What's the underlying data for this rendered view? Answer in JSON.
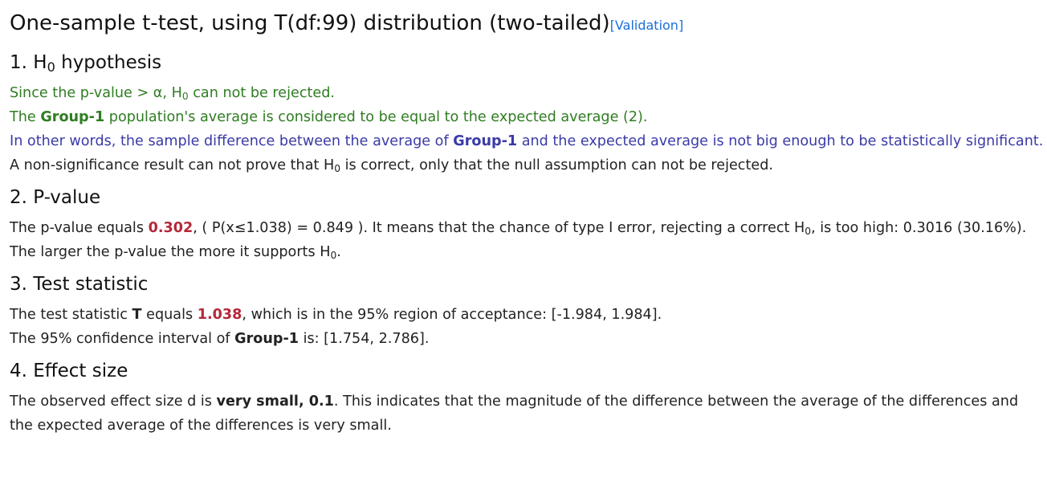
{
  "header": {
    "title": "One-sample t-test, using T(df:99) distribution (two-tailed)",
    "validation_link": "[Validation]"
  },
  "h0": {
    "heading_prefix": "1. H",
    "heading_sub": "0",
    "heading_suffix": " hypothesis",
    "line1_a": "Since the p-value > α, H",
    "line1_sub": "0",
    "line1_b": " can not be rejected.",
    "line2_a": "The ",
    "group_name": "Group-1",
    "line2_b": " population's average is considered to be equal to the expected average (2).",
    "line3_a": "In other words, the sample difference between the average of ",
    "line3_b": " and the expected average is not big enough to be statistically significant.",
    "line4_a": "A non-significance result can not prove that H",
    "line4_sub": "0",
    "line4_b": " is correct, only that the null assumption can not be rejected."
  },
  "pvalue": {
    "heading": "2. P-value",
    "text_a": "The p-value equals ",
    "value": "0.302",
    "text_b": ", ( P(x≤1.038) = 0.849 ). It means that the chance of type I error, rejecting a correct H",
    "sub1": "0",
    "text_c": ", is too high: 0.3016 (30.16%). The larger the p-value the more it supports H",
    "sub2": "0",
    "text_d": "."
  },
  "test_stat": {
    "heading": "3. Test statistic",
    "line1_a": "The test statistic ",
    "stat_symbol": "T",
    "line1_b": " equals ",
    "value": "1.038",
    "line1_c": ", which is in the 95% region of acceptance: [-1.984, 1.984].",
    "line2_a": "The 95% confidence interval of ",
    "line2_group": "Group-1",
    "line2_b": " is: [1.754, 2.786]."
  },
  "effect": {
    "heading": "4. Effect size",
    "text_a": "The observed effect size d is ",
    "magnitude": "very small",
    "sep": ", ",
    "value": "0.1",
    "text_b": ". This indicates that the magnitude of the difference between the average of the differences and the expected average of the differences is very small."
  }
}
